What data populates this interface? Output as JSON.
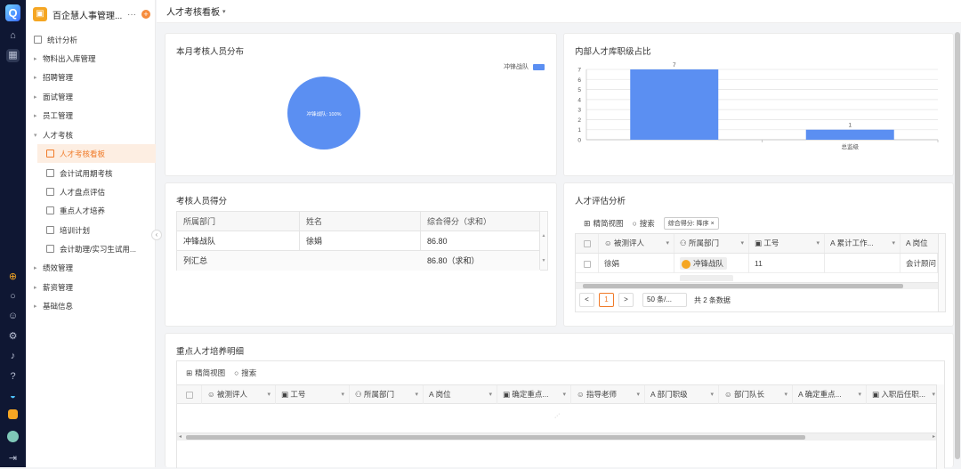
{
  "app": {
    "name": "百企慧人事管理...",
    "more": "···",
    "plus": "+",
    "logo_char": "Q",
    "app_icon": "briefcase-icon"
  },
  "rail": {
    "icons": [
      "home-icon",
      "apps-icon",
      "add-icon",
      "search-icon",
      "contacts-icon",
      "settings-icon",
      "bell-icon",
      "help-icon",
      "bot-icon",
      "image-icon",
      "avatar",
      "expand-icon"
    ]
  },
  "nav": {
    "items": [
      {
        "label": "统计分析",
        "type": "doc"
      },
      {
        "label": "物料出入库管理",
        "type": "group"
      },
      {
        "label": "招聘管理",
        "type": "group"
      },
      {
        "label": "面试管理",
        "type": "group"
      },
      {
        "label": "员工管理",
        "type": "group"
      },
      {
        "label": "人才考核",
        "type": "open"
      },
      {
        "label": "人才考核看板",
        "type": "sub",
        "selected": true
      },
      {
        "label": "会计试用期考核",
        "type": "sub"
      },
      {
        "label": "人才盘点评估",
        "type": "sub"
      },
      {
        "label": "重点人才培养",
        "type": "sub"
      },
      {
        "label": "培训计划",
        "type": "sub"
      },
      {
        "label": "会计助理/实习生试用...",
        "type": "sub"
      },
      {
        "label": "绩效管理",
        "type": "group"
      },
      {
        "label": "薪资管理",
        "type": "group"
      },
      {
        "label": "基础信息",
        "type": "group"
      }
    ]
  },
  "header": {
    "title": "人才考核看板",
    "caret": "▾"
  },
  "pie": {
    "title": "本月考核人员分布",
    "legend": "冲锋战队",
    "label": "冲锋战队: 100%",
    "color": "#5b8ff2"
  },
  "bar": {
    "title": "内部人才库职级占比"
  },
  "chart_data": {
    "type": "bar",
    "title": "内部人才库职级占比",
    "categories": [
      "",
      "总监级"
    ],
    "values": [
      7,
      1
    ],
    "ylim": [
      0,
      7
    ],
    "yticks": [
      "0",
      "1",
      "2",
      "3",
      "4",
      "5",
      "6",
      "7"
    ],
    "color": "#5b8ff2"
  },
  "score": {
    "title": "考核人员得分",
    "headers": [
      "所属部门",
      "姓名",
      "综合得分（求和）"
    ],
    "row": [
      "冲锋战队",
      "徐娟",
      "86.80"
    ],
    "total_label": "列汇总",
    "total_value": "86.80（求和）"
  },
  "analysis": {
    "title": "人才评估分析",
    "tool_view": "精简视图",
    "tool_search": "搜索",
    "filter_tag": "综合得分: 降序",
    "filter_close": "×",
    "headers": [
      "被测评人",
      "所属部门",
      "工号",
      "累计工作...",
      "岗位"
    ],
    "row": {
      "name": "徐娟",
      "dept": "冲锋战队",
      "id": "11",
      "post": "会计顾问"
    },
    "page_prev": "<",
    "page_num": "1",
    "page_next": ">",
    "page_size": "50 条/...",
    "total": "共 2 条数据"
  },
  "detail": {
    "title": "重点人才培养明细",
    "tool_view": "精简视图",
    "tool_search": "搜索",
    "headers": [
      "被测评人",
      "工号",
      "所属部门",
      "岗位",
      "确定重点...",
      "指导老师",
      "部门职级",
      "部门队长",
      "确定重点...",
      "入职后任职..."
    ]
  }
}
